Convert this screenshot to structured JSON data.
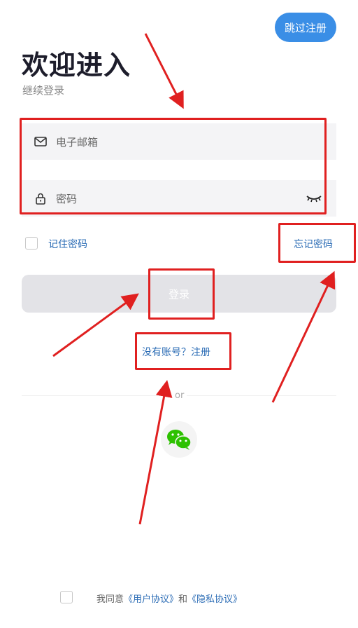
{
  "header": {
    "skip_label": "跳过注册",
    "title": "欢迎进入",
    "subtitle": "继续登录"
  },
  "form": {
    "email_placeholder": "电子邮箱",
    "password_placeholder": "密码",
    "remember_label": "记住密码",
    "forgot_label": "忘记密码",
    "login_label": "登录"
  },
  "register": {
    "link_label": "没有账号？注册"
  },
  "social": {
    "divider_text": "or",
    "wechat_icon": "wechat-icon"
  },
  "agreement": {
    "prefix": "我同意",
    "user_agreement": "《用户协议》",
    "and": "和",
    "privacy_policy": "《隐私协议》"
  },
  "colors": {
    "accent": "#3a8ee6",
    "link": "#2b6cb5",
    "annotation": "#e02020",
    "wechat": "#2dc100"
  }
}
